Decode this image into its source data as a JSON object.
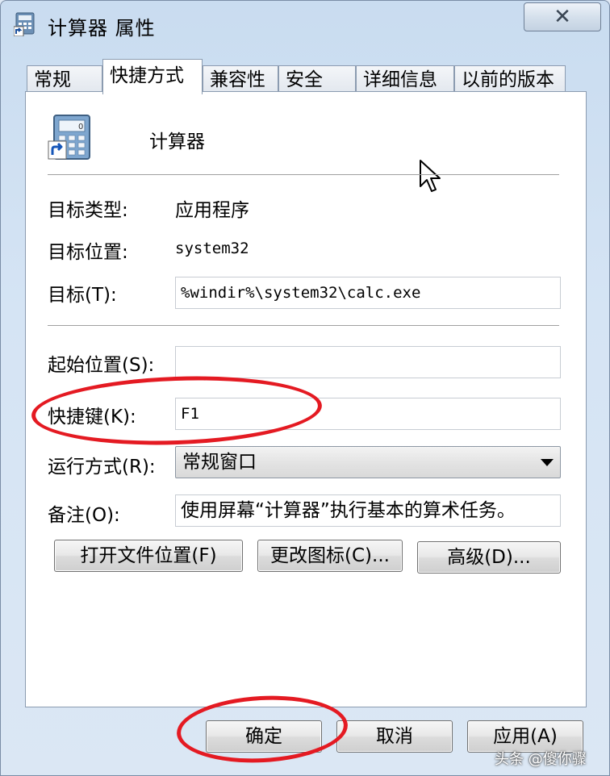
{
  "window": {
    "title": "计算器 属性",
    "close_label": "✕"
  },
  "tabs": [
    {
      "label": "常规"
    },
    {
      "label": "快捷方式"
    },
    {
      "label": "兼容性"
    },
    {
      "label": "安全"
    },
    {
      "label": "详细信息"
    },
    {
      "label": "以前的版本"
    }
  ],
  "shortcut": {
    "name": "计算器",
    "target_type_label": "目标类型:",
    "target_type_value": "应用程序",
    "target_location_label": "目标位置:",
    "target_location_value": "system32",
    "target_label": "目标(T):",
    "target_value": "%windir%\\system32\\calc.exe",
    "start_in_label": "起始位置(S):",
    "start_in_value": "",
    "hotkey_label": "快捷键(K):",
    "hotkey_value": "F1",
    "run_label": "运行方式(R):",
    "run_value": "常规窗口",
    "comment_label": "备注(O):",
    "comment_value": "使用屏幕“计算器”执行基本的算术任务。"
  },
  "buttons": {
    "open_location": "打开文件位置(F)",
    "change_icon": "更改图标(C)...",
    "advanced": "高级(D)...",
    "ok": "确定",
    "cancel": "取消",
    "apply": "应用(A)"
  },
  "watermark": "头条 @傻你骤",
  "icons": [
    "calculator-icon",
    "shortcut-arrow-icon",
    "close-icon",
    "chevron-down-icon",
    "mouse-cursor-icon"
  ],
  "colors": {
    "highlight_circle": "#e41a22",
    "window_bg": "#d5e4f4"
  }
}
